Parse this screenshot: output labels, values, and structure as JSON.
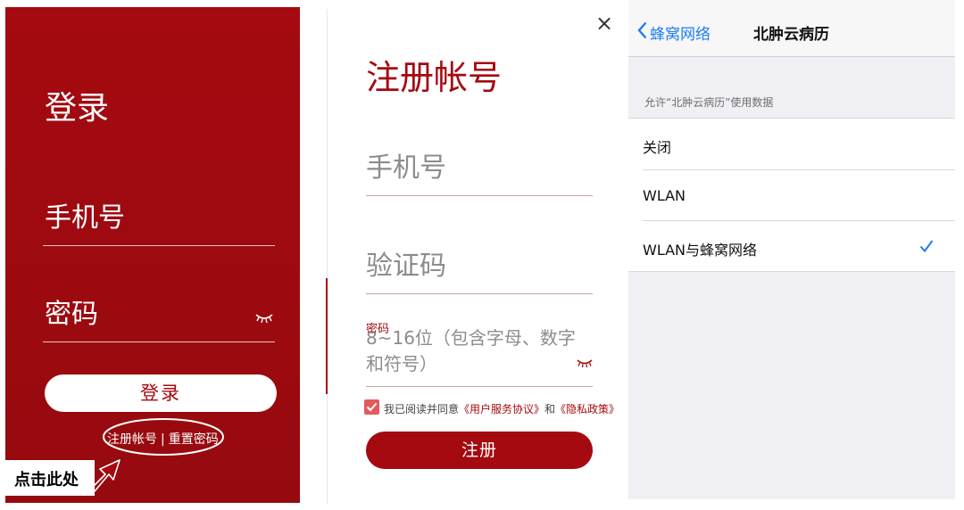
{
  "login": {
    "title": "登录",
    "phone_placeholder": "手机号",
    "password_placeholder": "密码",
    "login_button": "登录",
    "register_link": "注册帐号",
    "separator": "|",
    "reset_link": "重置密码",
    "annotation": "点击此处",
    "colors": {
      "background": "#a40a10",
      "button": "#ffffff"
    }
  },
  "register": {
    "close_icon": "×",
    "title": "注册帐号",
    "phone_placeholder": "手机号",
    "code_placeholder": "验证码",
    "password_label": "密码",
    "password_placeholder": "8~16位（包含字母、数字和符号）",
    "agree_prefix": "我已阅读并同意",
    "terms_link": "《用户服务协议》",
    "agree_and": "和",
    "privacy_link": "《隐私政策》",
    "register_button": "注册",
    "agree_checked": true,
    "colors": {
      "accent": "#a40a10",
      "checkbox": "#e35a5e"
    }
  },
  "ios": {
    "back_label": "蜂窝网络",
    "nav_title": "北肿云病历",
    "section_header": "允许“北肿云病历”使用数据",
    "options": [
      {
        "label": "关闭",
        "selected": false
      },
      {
        "label": "WLAN",
        "selected": false
      },
      {
        "label": "WLAN与蜂窝网络",
        "selected": true
      }
    ],
    "check_icon": "checkmark-icon",
    "colors": {
      "tint": "#1d7ef2",
      "background": "#efeff4"
    }
  }
}
